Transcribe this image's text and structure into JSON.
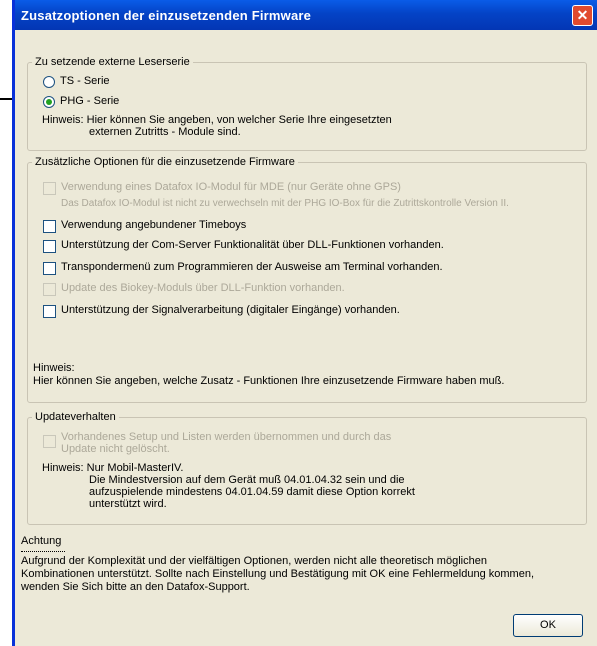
{
  "window": {
    "title": "Zusatzoptionen der einzusetzenden Firmware",
    "close_glyph": "✕"
  },
  "leser": {
    "legend": "Zu setzende externe Leserserie",
    "options": [
      {
        "label": "TS - Serie",
        "selected": false
      },
      {
        "label": "PHG - Serie",
        "selected": true
      }
    ],
    "hint1": "Hinweis: Hier können Sie angeben, von welcher Serie Ihre eingesetzten",
    "hint2": "externen Zutritts - Module sind."
  },
  "optionen": {
    "legend": "Zusätzliche Optionen für die einzusetzende Firmware",
    "items": [
      {
        "label": "Verwendung eines Datafox IO-Modul für MDE (nur Geräte ohne GPS)",
        "enabled": false,
        "checked": false
      },
      {
        "label": "Verwendung angebundener Timeboys",
        "enabled": true,
        "checked": false
      },
      {
        "label": "Unterstützung der Com-Server Funktionalität über DLL-Funktionen vorhanden.",
        "enabled": true,
        "checked": false
      },
      {
        "label": "Transpondermenü zum Programmieren der Ausweise am Terminal vorhanden.",
        "enabled": true,
        "checked": false
      },
      {
        "label": "Update des Biokey-Moduls über DLL-Funktion vorhanden.",
        "enabled": false,
        "checked": false
      },
      {
        "label": "Unterstützung der Signalverarbeitung (digitaler Eingänge) vorhanden.",
        "enabled": true,
        "checked": false
      }
    ],
    "io_note": "Das Datafox IO-Modul ist nicht zu verwechseln mit der PHG IO-Box für die Zutrittskontrolle Version II.",
    "hint1": "Hinweis:",
    "hint2": "Hier können Sie angeben, welche Zusatz - Funktionen Ihre einzusetzende Firmware haben muß."
  },
  "update": {
    "legend": "Updateverhalten",
    "cb1": "Vorhandenes Setup und Listen werden übernommen und durch das",
    "cb2": "Update nicht gelöscht.",
    "h1": "Hinweis: Nur Mobil-MasterIV.",
    "h2": "Die Mindestversion auf dem Gerät muß 04.01.04.32 sein und die",
    "h3": "aufzuspielende mindestens 04.01.04.59 damit diese Option korrekt",
    "h4": "unterstützt wird."
  },
  "achtung": {
    "title": "Achtung",
    "l1": "Aufgrund der Komplexität und der vielfältigen Optionen, werden nicht alle theoretisch möglichen",
    "l2": "Kombinationen unterstützt. Sollte nach Einstellung und Bestätigung mit OK eine Fehlermeldung kommen,",
    "l3": "wenden Sie Sich bitte an den Datafox-Support."
  },
  "ok_label": "OK"
}
